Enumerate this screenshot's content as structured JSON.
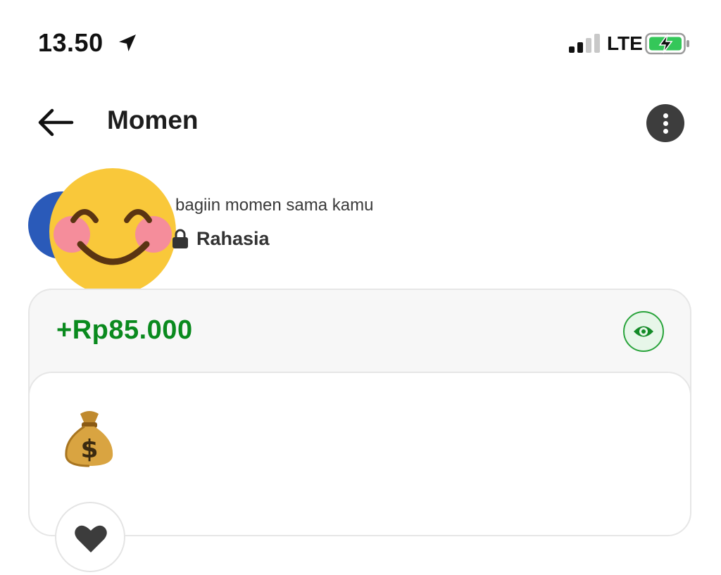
{
  "status_bar": {
    "time": "13.50",
    "network": "LTE"
  },
  "header": {
    "title": "Momen"
  },
  "post": {
    "share_text": "bagiin momen sama kamu",
    "privacy": "Rahasia"
  },
  "card": {
    "amount": "+Rp85.000",
    "emoji": "money-bag"
  },
  "colors": {
    "amount_green": "#0a8a1e",
    "avatar_blue": "#2a5ab9",
    "eye_button_bg": "#e7f6e9"
  },
  "icons": {
    "back": "arrow-left-icon",
    "more": "more-vertical-icon",
    "eye": "eye-icon",
    "lock": "lock-icon",
    "like": "heart-icon"
  }
}
